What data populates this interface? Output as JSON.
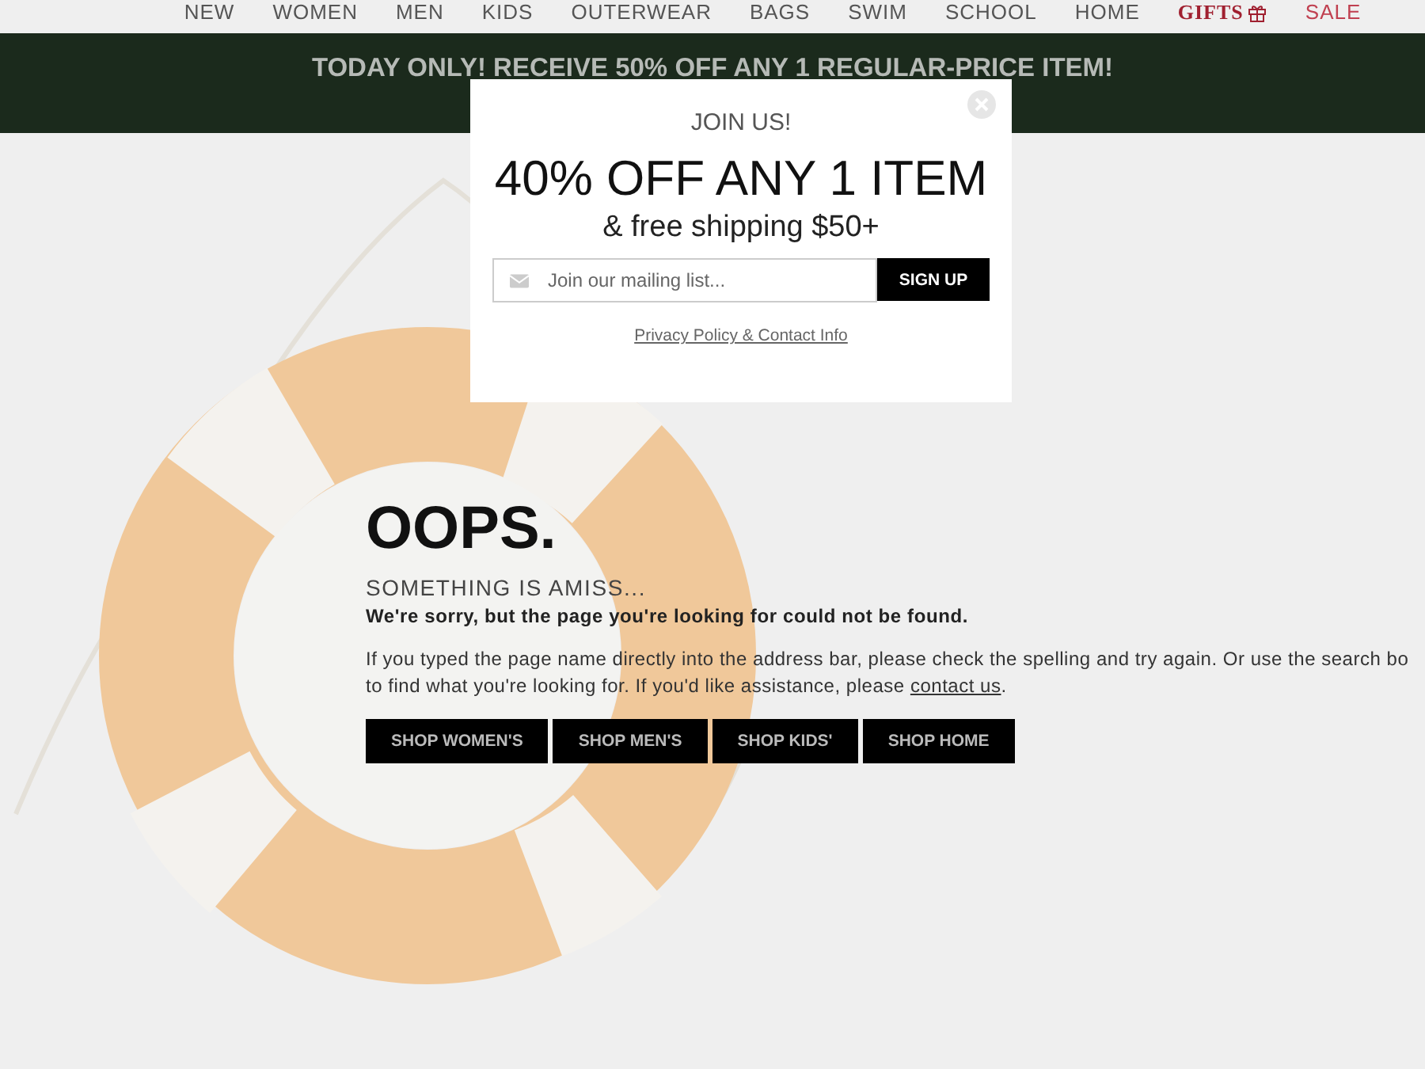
{
  "nav": {
    "items": [
      {
        "label": "NEW",
        "kind": "plain"
      },
      {
        "label": "WOMEN",
        "kind": "plain"
      },
      {
        "label": "MEN",
        "kind": "plain"
      },
      {
        "label": "KIDS",
        "kind": "plain"
      },
      {
        "label": "OUTERWEAR",
        "kind": "plain"
      },
      {
        "label": "BAGS",
        "kind": "plain"
      },
      {
        "label": "SWIM",
        "kind": "plain"
      },
      {
        "label": "SCHOOL",
        "kind": "plain"
      },
      {
        "label": "HOME",
        "kind": "plain"
      },
      {
        "label": "GIFTS",
        "kind": "gifts"
      },
      {
        "label": "SALE",
        "kind": "sale"
      }
    ]
  },
  "promo_banner": {
    "text": "TODAY ONLY! RECEIVE 50% OFF ANY 1 REGULAR-PRICE ITEM!"
  },
  "error_page": {
    "heading": "OOPS.",
    "subheading": "SOMETHING IS AMISS...",
    "lead": "We're sorry, but the page you're looking for could not be found.",
    "message": {
      "line_1": "If you typed the page name directly into the address bar, please check the spelling and try again. Or use the search bo",
      "line_2": "to find what you're looking for. If you'd like assistance, please ",
      "link": "contact us",
      "end": "."
    },
    "buttons": [
      "SHOP WOMEN'S",
      "SHOP MEN'S",
      "SHOP KIDS'",
      "SHOP HOME"
    ]
  },
  "popup": {
    "kicker": "JOIN US!",
    "headline": "40% OFF ANY 1 ITEM",
    "subline": "& free shipping $50+",
    "email_field": {
      "placeholder": "Join our mailing list..."
    },
    "submit": "SIGN UP",
    "link": "Privacy Policy & Contact Info"
  }
}
